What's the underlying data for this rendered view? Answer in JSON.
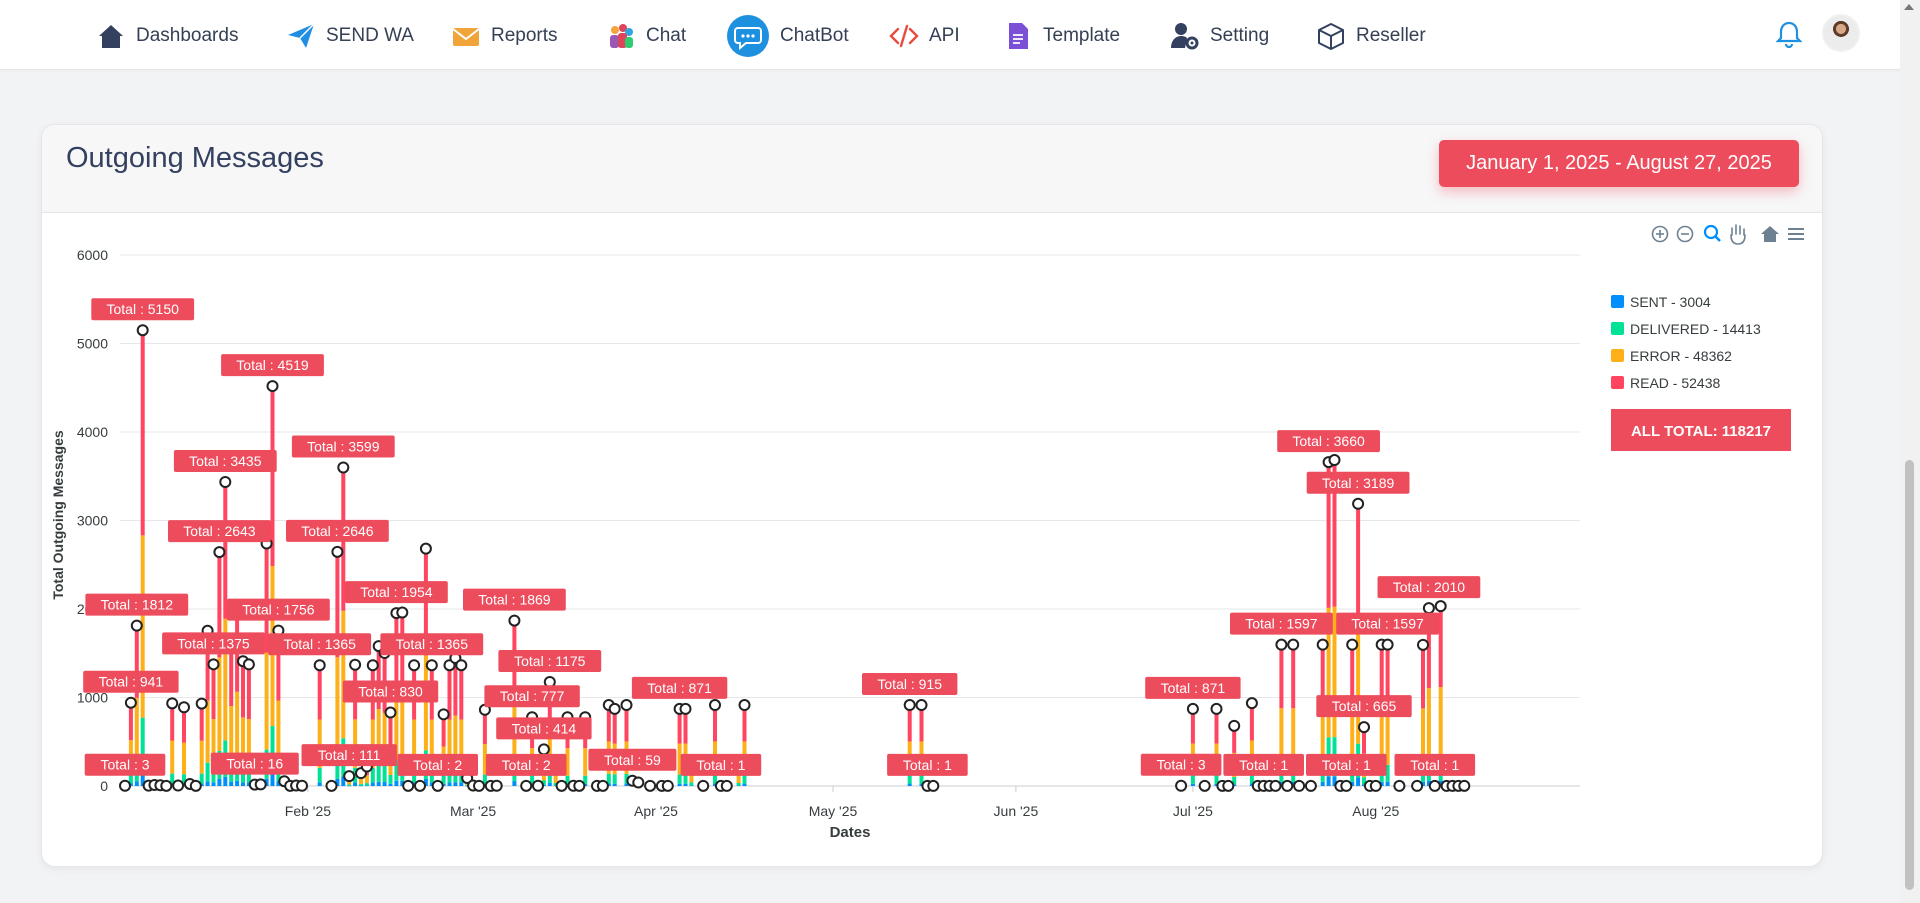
{
  "nav": {
    "items": [
      {
        "label": "Dashboards",
        "icon": "home-icon"
      },
      {
        "label": "SEND WA",
        "icon": "paper-plane-icon"
      },
      {
        "label": "Reports",
        "icon": "envelope-icon"
      },
      {
        "label": "Chat",
        "icon": "people-icon"
      },
      {
        "label": "ChatBot",
        "icon": "chat-bubble-icon"
      },
      {
        "label": "API",
        "icon": "code-icon"
      },
      {
        "label": "Template",
        "icon": "document-icon"
      },
      {
        "label": "Setting",
        "icon": "user-gear-icon"
      },
      {
        "label": "Reseller",
        "icon": "box-icon"
      }
    ],
    "notification_icon": "bell-icon",
    "avatar_icon": "user-avatar-icon"
  },
  "card": {
    "title": "Outgoing Messages",
    "date_range": "January 1, 2025 - August 27, 2025"
  },
  "toolbar": {
    "zoom_in": "zoom-in-icon",
    "zoom_out": "zoom-out-icon",
    "selection_zoom": "magnifier-icon",
    "pan": "hand-icon",
    "reset": "home-icon",
    "menu": "menu-icon"
  },
  "colors": {
    "sent": "#008ffb",
    "delivered": "#00e396",
    "error": "#feb019",
    "read": "#ff4560",
    "accent": "#ed4c5c",
    "nav_text": "#344054"
  },
  "chart_data": {
    "type": "bar",
    "stacked": true,
    "xlabel": "Dates",
    "ylabel": "Total Outgoing Messages",
    "ylim": [
      0,
      6000
    ],
    "yticks": [
      0,
      1000,
      2000,
      3000,
      4000,
      5000,
      6000
    ],
    "xticks": [
      "Feb '25",
      "Mar '25",
      "Apr '25",
      "May '25",
      "Jun '25",
      "Jul '25",
      "Aug '25"
    ],
    "legend": [
      {
        "name": "SENT - 3004",
        "color": "#008ffb"
      },
      {
        "name": "DELIVERED - 14413",
        "color": "#00e396"
      },
      {
        "name": "ERROR - 48362",
        "color": "#feb019"
      },
      {
        "name": "READ - 52438",
        "color": "#ff4560"
      }
    ],
    "all_total_label": "ALL TOTAL: ",
    "all_total_value": "118217",
    "total_label_prefix": "Total : ",
    "points": [
      {
        "date": "2025-01-01",
        "total": 3
      },
      {
        "date": "2025-01-02",
        "total": 941
      },
      {
        "date": "2025-01-03",
        "total": 1812
      },
      {
        "date": "2025-01-04",
        "total": 5150
      },
      {
        "date": "2025-01-05",
        "total": 4
      },
      {
        "date": "2025-01-06",
        "total": 12
      },
      {
        "date": "2025-01-07",
        "total": 8
      },
      {
        "date": "2025-01-08",
        "total": 2
      },
      {
        "date": "2025-01-09",
        "total": 934
      },
      {
        "date": "2025-01-10",
        "total": 5
      },
      {
        "date": "2025-01-11",
        "total": 890
      },
      {
        "date": "2025-01-12",
        "total": 23
      },
      {
        "date": "2025-01-13",
        "total": 2
      },
      {
        "date": "2025-01-14",
        "total": 931
      },
      {
        "date": "2025-01-15",
        "total": 1754
      },
      {
        "date": "2025-01-16",
        "total": 1375
      },
      {
        "date": "2025-01-17",
        "total": 2643
      },
      {
        "date": "2025-01-18",
        "total": 3435
      },
      {
        "date": "2025-01-19",
        "total": 1642
      },
      {
        "date": "2025-01-20",
        "total": 1936
      },
      {
        "date": "2025-01-21",
        "total": 1410
      },
      {
        "date": "2025-01-22",
        "total": 1374
      },
      {
        "date": "2025-01-23",
        "total": 16
      },
      {
        "date": "2025-01-24",
        "total": 18
      },
      {
        "date": "2025-01-25",
        "total": 2740
      },
      {
        "date": "2025-01-26",
        "total": 4519
      },
      {
        "date": "2025-01-27",
        "total": 1756
      },
      {
        "date": "2025-01-28",
        "total": 54
      },
      {
        "date": "2025-01-29",
        "total": 2
      },
      {
        "date": "2025-01-30",
        "total": 5
      },
      {
        "date": "2025-01-31",
        "total": 3
      },
      {
        "date": "2025-02-03",
        "total": 1365
      },
      {
        "date": "2025-02-05",
        "total": 2
      },
      {
        "date": "2025-02-06",
        "total": 2646
      },
      {
        "date": "2025-02-07",
        "total": 3599
      },
      {
        "date": "2025-02-08",
        "total": 111
      },
      {
        "date": "2025-02-09",
        "total": 1370
      },
      {
        "date": "2025-02-10",
        "total": 145
      },
      {
        "date": "2025-02-11",
        "total": 220
      },
      {
        "date": "2025-02-12",
        "total": 1365
      },
      {
        "date": "2025-02-13",
        "total": 1581
      },
      {
        "date": "2025-02-14",
        "total": 1503
      },
      {
        "date": "2025-02-15",
        "total": 830
      },
      {
        "date": "2025-02-16",
        "total": 1954
      },
      {
        "date": "2025-02-17",
        "total": 1960
      },
      {
        "date": "2025-02-18",
        "total": 2
      },
      {
        "date": "2025-02-19",
        "total": 1365
      },
      {
        "date": "2025-02-20",
        "total": 2
      },
      {
        "date": "2025-02-21",
        "total": 2682
      },
      {
        "date": "2025-02-22",
        "total": 1365
      },
      {
        "date": "2025-02-23",
        "total": 2
      },
      {
        "date": "2025-02-24",
        "total": 810
      },
      {
        "date": "2025-02-25",
        "total": 1365
      },
      {
        "date": "2025-02-26",
        "total": 1446
      },
      {
        "date": "2025-02-27",
        "total": 1365
      },
      {
        "date": "2025-02-28",
        "total": 90
      },
      {
        "date": "2025-03-01",
        "total": 5
      },
      {
        "date": "2025-03-02",
        "total": 2
      },
      {
        "date": "2025-03-03",
        "total": 861
      },
      {
        "date": "2025-03-04",
        "total": 2
      },
      {
        "date": "2025-03-05",
        "total": 3
      },
      {
        "date": "2025-03-08",
        "total": 1869
      },
      {
        "date": "2025-03-10",
        "total": 2
      },
      {
        "date": "2025-03-11",
        "total": 777
      },
      {
        "date": "2025-03-12",
        "total": 3
      },
      {
        "date": "2025-03-13",
        "total": 414
      },
      {
        "date": "2025-03-14",
        "total": 1175
      },
      {
        "date": "2025-03-15",
        "total": 238
      },
      {
        "date": "2025-03-16",
        "total": 2
      },
      {
        "date": "2025-03-17",
        "total": 777
      },
      {
        "date": "2025-03-18",
        "total": 3
      },
      {
        "date": "2025-03-19",
        "total": 2
      },
      {
        "date": "2025-03-20",
        "total": 777
      },
      {
        "date": "2025-03-22",
        "total": 2
      },
      {
        "date": "2025-03-23",
        "total": 2
      },
      {
        "date": "2025-03-24",
        "total": 915
      },
      {
        "date": "2025-03-25",
        "total": 871
      },
      {
        "date": "2025-03-27",
        "total": 915
      },
      {
        "date": "2025-03-28",
        "total": 59
      },
      {
        "date": "2025-03-29",
        "total": 40
      },
      {
        "date": "2025-03-31",
        "total": 2
      },
      {
        "date": "2025-04-02",
        "total": 2
      },
      {
        "date": "2025-04-03",
        "total": 2
      },
      {
        "date": "2025-04-05",
        "total": 871
      },
      {
        "date": "2025-04-06",
        "total": 871
      },
      {
        "date": "2025-04-07",
        "total": 272
      },
      {
        "date": "2025-04-09",
        "total": 2
      },
      {
        "date": "2025-04-11",
        "total": 915
      },
      {
        "date": "2025-04-12",
        "total": 1
      },
      {
        "date": "2025-04-13",
        "total": 1
      },
      {
        "date": "2025-04-15",
        "total": 227
      },
      {
        "date": "2025-04-16",
        "total": 915
      },
      {
        "date": "2025-05-14",
        "total": 915
      },
      {
        "date": "2025-05-16",
        "total": 915
      },
      {
        "date": "2025-05-17",
        "total": 1
      },
      {
        "date": "2025-05-18",
        "total": 1
      },
      {
        "date": "2025-06-29",
        "total": 3
      },
      {
        "date": "2025-07-01",
        "total": 871
      },
      {
        "date": "2025-07-03",
        "total": 2
      },
      {
        "date": "2025-07-05",
        "total": 871
      },
      {
        "date": "2025-07-06",
        "total": 2
      },
      {
        "date": "2025-07-07",
        "total": 2
      },
      {
        "date": "2025-07-08",
        "total": 680
      },
      {
        "date": "2025-07-11",
        "total": 936
      },
      {
        "date": "2025-07-12",
        "total": 2
      },
      {
        "date": "2025-07-13",
        "total": 1
      },
      {
        "date": "2025-07-14",
        "total": 2
      },
      {
        "date": "2025-07-15",
        "total": 1
      },
      {
        "date": "2025-07-16",
        "total": 1597
      },
      {
        "date": "2025-07-17",
        "total": 1
      },
      {
        "date": "2025-07-18",
        "total": 1597
      },
      {
        "date": "2025-07-19",
        "total": 1
      },
      {
        "date": "2025-07-21",
        "total": 1
      },
      {
        "date": "2025-07-23",
        "total": 1597
      },
      {
        "date": "2025-07-24",
        "total": 3660
      },
      {
        "date": "2025-07-25",
        "total": 3683
      },
      {
        "date": "2025-07-26",
        "total": 1
      },
      {
        "date": "2025-07-27",
        "total": 1
      },
      {
        "date": "2025-07-28",
        "total": 1597
      },
      {
        "date": "2025-07-29",
        "total": 3189
      },
      {
        "date": "2025-07-30",
        "total": 665
      },
      {
        "date": "2025-07-31",
        "total": 1
      },
      {
        "date": "2025-08-01",
        "total": 1
      },
      {
        "date": "2025-08-02",
        "total": 1597
      },
      {
        "date": "2025-08-03",
        "total": 1597
      },
      {
        "date": "2025-08-05",
        "total": 1
      },
      {
        "date": "2025-08-08",
        "total": 1
      },
      {
        "date": "2025-08-09",
        "total": 1595
      },
      {
        "date": "2025-08-10",
        "total": 2010
      },
      {
        "date": "2025-08-11",
        "total": 1
      },
      {
        "date": "2025-08-12",
        "total": 2032
      },
      {
        "date": "2025-08-13",
        "total": 1
      },
      {
        "date": "2025-08-14",
        "total": 1
      },
      {
        "date": "2025-08-15",
        "total": 2
      },
      {
        "date": "2025-08-16",
        "total": 2
      }
    ]
  }
}
